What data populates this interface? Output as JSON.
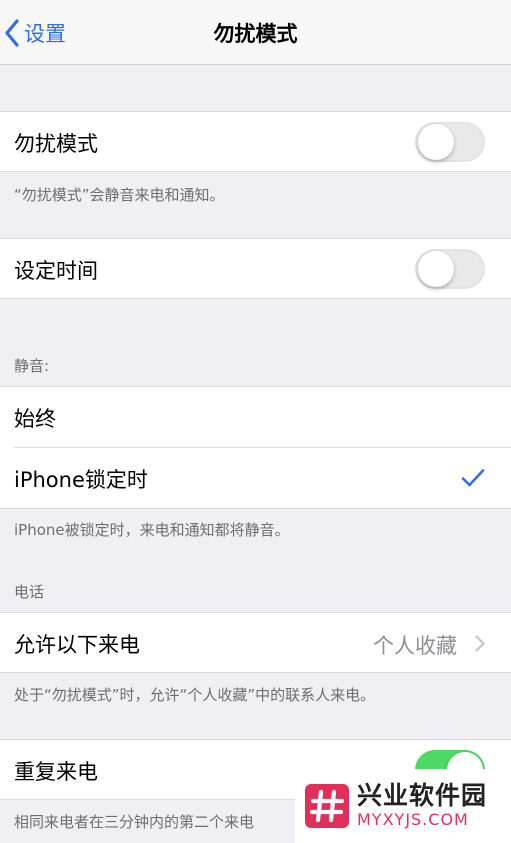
{
  "nav": {
    "back_label": "设置",
    "title": "勿扰模式"
  },
  "dnd": {
    "label": "勿扰模式",
    "toggle_on": false,
    "footnote": "“勿扰模式”会静音来电和通知。"
  },
  "schedule": {
    "label": "设定时间",
    "toggle_on": false
  },
  "silence": {
    "header": "静音:",
    "options": [
      {
        "label": "始终",
        "checked": false
      },
      {
        "label": "iPhone锁定时",
        "checked": true
      }
    ],
    "footnote": "iPhone被锁定时，来电和通知都将静音。"
  },
  "phone": {
    "header": "电话",
    "allow_calls_label": "允许以下来电",
    "allow_calls_value": "个人收藏",
    "allow_calls_footnote": "处于“勿扰模式”时，允许“个人收藏”中的联系人来电。",
    "repeated_calls_label": "重复来电",
    "repeated_calls_on": true,
    "repeated_calls_footnote": "相同来电者在三分钟内的第二个来电"
  },
  "watermark": {
    "brand_cn": "兴业软件园",
    "brand_en": "MYXYJS.COM"
  },
  "colors": {
    "accent": "#2f6fe0",
    "toggle_on": "#4cd964",
    "watermark_red": "#e0305a"
  }
}
